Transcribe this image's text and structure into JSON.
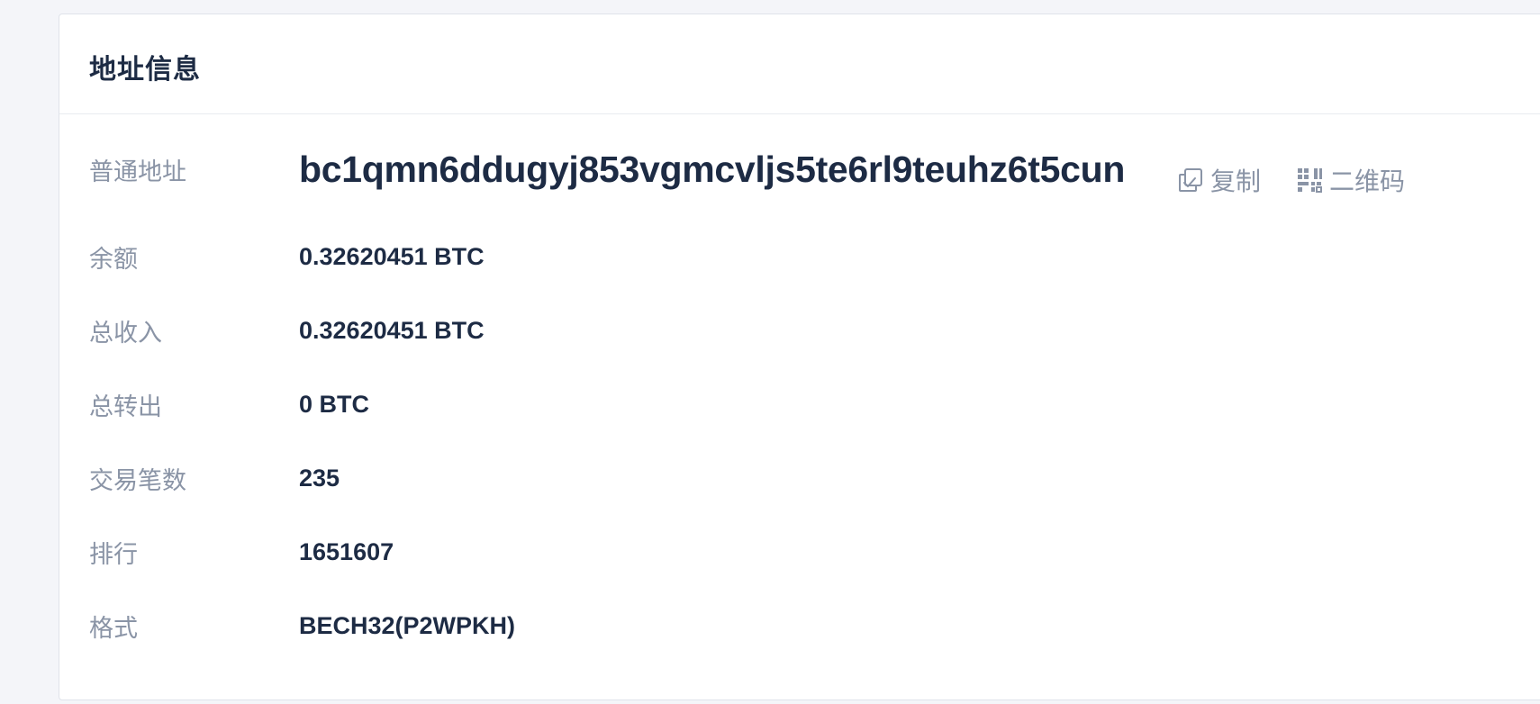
{
  "card": {
    "title": "地址信息"
  },
  "address": {
    "label": "普通地址",
    "value": "bc1qmn6ddugyj853vgmcvljs5te6rl9teuhz6t5cun",
    "copy_label": "复制",
    "qr_label": "二维码",
    "copy_icon": "copy-icon",
    "qr_icon": "qrcode-icon"
  },
  "rows": [
    {
      "label": "余额",
      "value": "0.32620451 BTC"
    },
    {
      "label": "总收入",
      "value": "0.32620451 BTC"
    },
    {
      "label": "总转出",
      "value": "0 BTC"
    },
    {
      "label": "交易笔数",
      "value": "235"
    },
    {
      "label": "排行",
      "value": "1651607"
    },
    {
      "label": "格式",
      "value": "BECH32(P2WPKH)"
    }
  ],
  "colors": {
    "background": "#f4f5f9",
    "card": "#ffffff",
    "text_primary": "#1d2b44",
    "text_secondary": "#8a94a6"
  }
}
